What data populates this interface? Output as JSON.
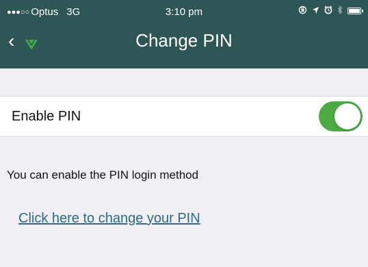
{
  "status_bar": {
    "signal": "●●●○○",
    "carrier": "Optus",
    "network": "3G",
    "time": "3:10 pm",
    "icons": [
      "lock-rotation-icon",
      "location-arrow-icon",
      "alarm-icon",
      "bluetooth-icon",
      "battery-icon"
    ]
  },
  "nav": {
    "back_icon": "chevron-left-icon",
    "back_glyph": "‹",
    "logo_icon": "app-logo-icon",
    "title": "Change PIN"
  },
  "settings": {
    "enable_pin_label": "Enable PIN",
    "enable_pin_on": true
  },
  "main": {
    "help_text": "You can enable the PIN login method",
    "change_link": "Click here to change your PIN"
  },
  "colors": {
    "header_bg": "#2e5656",
    "toggle_on": "#4caa45",
    "link": "#2a6a88",
    "logo_green": "#3fae49"
  }
}
